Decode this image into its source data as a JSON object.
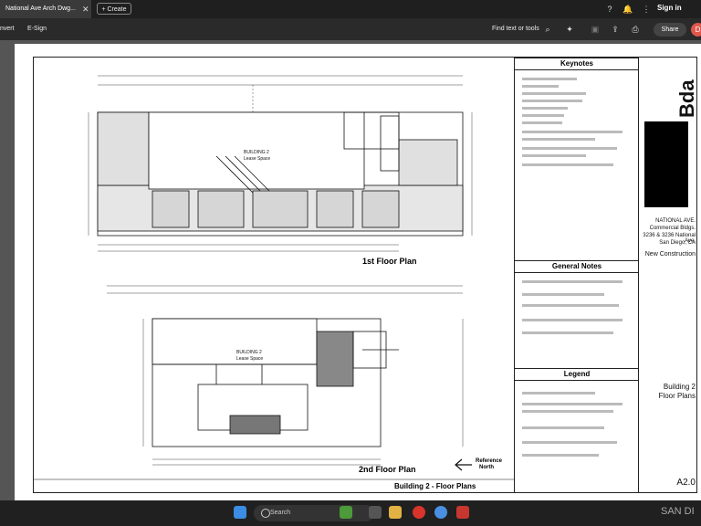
{
  "tabbar": {
    "tab_title": "National Ave Arch  Dwg...",
    "create_label": "+ Create",
    "signin_label": "Sign in"
  },
  "toolbar": {
    "convert_label": "nvert",
    "esign_label": "E-Sign",
    "find_label": "Find text or tools",
    "share_label": "Share"
  },
  "drawing": {
    "floor1_title": "1st Floor Plan",
    "floor2_title": "2nd Floor Plan",
    "reference_north": "Reference\nNorth",
    "reference_label": "Reference",
    "north_label": "North",
    "sheet_title": "Building 2 - Floor Plans",
    "building_label_1": "BUILDING 2",
    "lease_label_1": "Lease Space",
    "building_label_2": "BUILDING 2",
    "lease_label_2": "Lease Space"
  },
  "notes": {
    "keynotes_title": "Keynotes",
    "general_title": "General Notes",
    "legend_title": "Legend"
  },
  "titleblock": {
    "logo": "Bda",
    "project_name": "NATIONAL AVE.",
    "project_sub": "Commercial Bldgs.",
    "address": "3236 & 3236 National Ave.",
    "city": "San Diego, CA",
    "project_type": "New Construction",
    "sheet_name_1": "Building 2",
    "sheet_name_2": "Floor Plans",
    "sheet_number": "A2.0"
  },
  "taskbar": {
    "search_label": "Search",
    "right_text": "SAN DI"
  }
}
